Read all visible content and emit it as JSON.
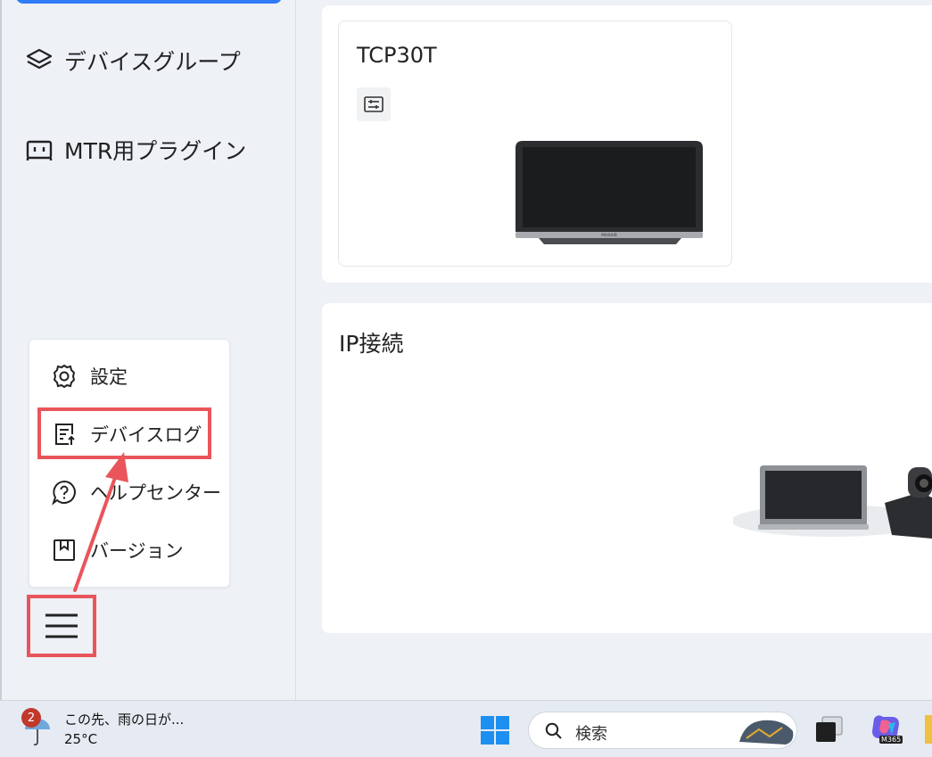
{
  "sidebar": {
    "items": [
      {
        "label": "デバイスグループ",
        "icon": "layers-icon"
      },
      {
        "label": "MTR用プラグイン",
        "icon": "plugin-icon"
      }
    ],
    "popup_menu": [
      {
        "label": "設定",
        "icon": "gear-icon"
      },
      {
        "label": "デバイスログ",
        "icon": "log-upload-icon"
      },
      {
        "label": "ヘルプセンター",
        "icon": "help-icon"
      },
      {
        "label": "バージョン",
        "icon": "version-icon"
      }
    ]
  },
  "main": {
    "device": {
      "name": "TCP30T",
      "brand": "MAXHUB"
    },
    "section_title": "IP接続"
  },
  "taskbar": {
    "weather_badge": "2",
    "weather_text": "この先、雨の日が...",
    "temperature": "25°C",
    "search_label": "検索",
    "m365_label": "M365"
  },
  "colors": {
    "accent": "#2f7cf6",
    "highlight": "#e9555b"
  }
}
